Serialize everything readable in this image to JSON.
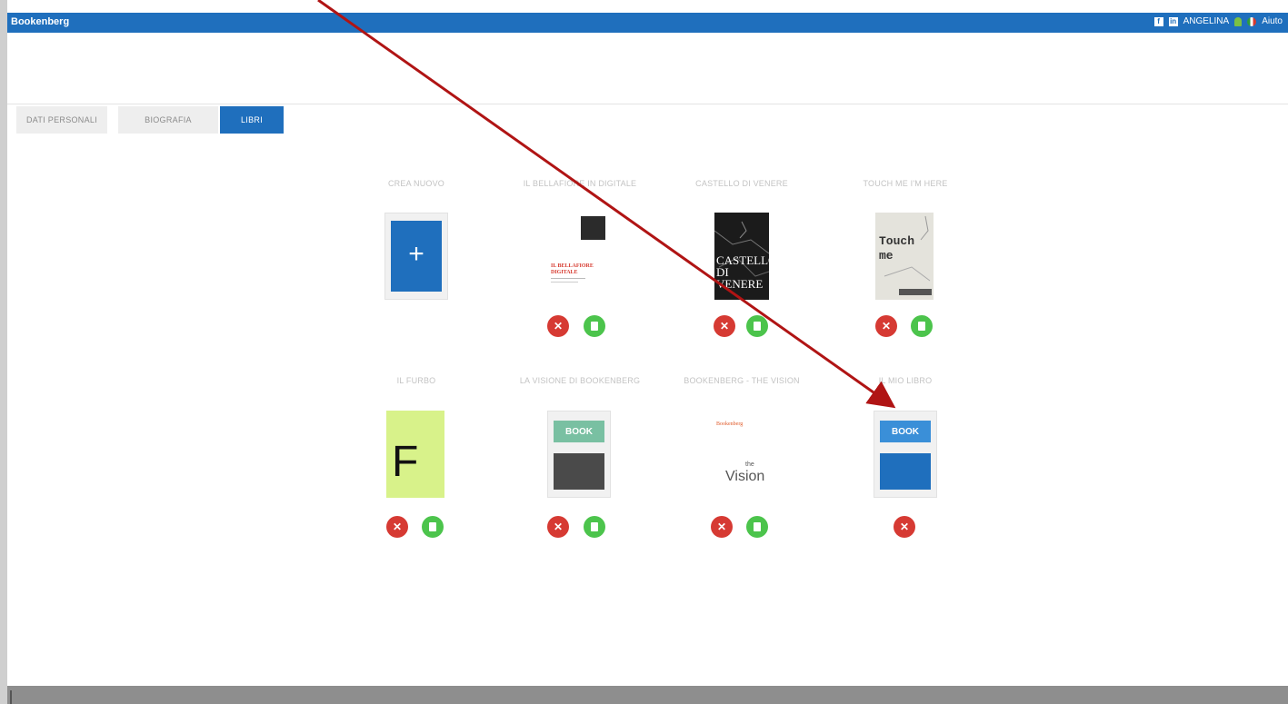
{
  "header": {
    "app_title": "Bookenberg",
    "facebook_icon": "f",
    "linkedin_icon": "in",
    "user_name": "ANGELINA",
    "help_label": "Aiuto"
  },
  "tabs": [
    {
      "label": "DATI PERSONALI",
      "active": false
    },
    {
      "label": "BIOGRAFIA",
      "active": false
    },
    {
      "label": "LIBRI",
      "active": true
    }
  ],
  "books": [
    {
      "title": "CREA NUOVO",
      "cover": "create-new",
      "plus": "+",
      "actions": []
    },
    {
      "title": "IL BELLAFIORE IN DIGITALE",
      "cover": "bellafiore",
      "cover_text": "IL BELLAFIORE DIGITALE",
      "actions": [
        "delete",
        "edit"
      ]
    },
    {
      "title": "CASTELLO DI VENERE",
      "cover": "castello",
      "cover_text": "CASTELLO DI VENERE",
      "actions": [
        "delete",
        "edit"
      ]
    },
    {
      "title": "TOUCH ME I'M HERE",
      "cover": "touch",
      "cover_text": "Touch me",
      "actions": [
        "delete",
        "edit"
      ]
    },
    {
      "title": "IL FURBO",
      "cover": "furbo",
      "cover_text": "F",
      "actions": [
        "delete",
        "edit"
      ]
    },
    {
      "title": "LA VISIONE DI BOOKENBERG",
      "cover": "book-gray",
      "cover_text": "BOOK",
      "actions": [
        "delete",
        "edit"
      ]
    },
    {
      "title": "BOOKENBERG - THE VISION",
      "cover": "vision",
      "cover_text": "Vision",
      "cover_sup": "the",
      "cover_brand": "Bookenberg",
      "actions": [
        "delete",
        "edit"
      ]
    },
    {
      "title": "IL MIO LIBRO",
      "cover": "book-blue",
      "cover_text": "BOOK",
      "actions": [
        "delete"
      ]
    }
  ],
  "action_glyphs": {
    "delete": "✕",
    "edit": "document-icon"
  },
  "annotation": {
    "arrow_color": "#b01414"
  },
  "colors": {
    "topbar": "#1f6fbd",
    "delete": "#d63a33",
    "edit": "#4cc44c",
    "tab_active": "#1f6fbd"
  }
}
